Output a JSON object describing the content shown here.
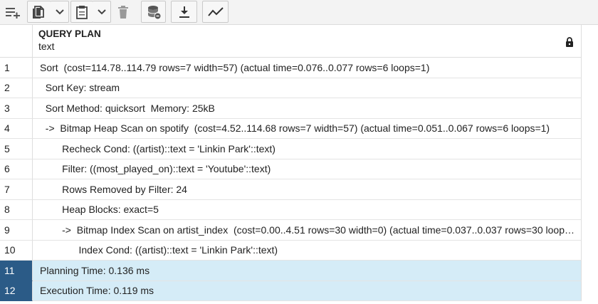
{
  "toolbar": {
    "buttons": [
      {
        "name": "add-row-icon"
      },
      {
        "name": "copy-icon"
      },
      {
        "name": "copy-dropdown-icon"
      },
      {
        "name": "paste-icon"
      },
      {
        "name": "paste-dropdown-icon"
      },
      {
        "name": "delete-icon"
      },
      {
        "name": "save-data-icon"
      },
      {
        "name": "download-icon"
      },
      {
        "name": "graph-visualiser-icon"
      }
    ]
  },
  "grid": {
    "column_header": {
      "title": "QUERY PLAN",
      "type": "text",
      "locked": true
    },
    "rows": [
      {
        "num": "1",
        "text": "Sort  (cost=114.78..114.79 rows=7 width=57) (actual time=0.076..0.077 rows=6 loops=1)",
        "selected": false
      },
      {
        "num": "2",
        "text": "  Sort Key: stream",
        "selected": false
      },
      {
        "num": "3",
        "text": "  Sort Method: quicksort  Memory: 25kB",
        "selected": false
      },
      {
        "num": "4",
        "text": "  ->  Bitmap Heap Scan on spotify  (cost=4.52..114.68 rows=7 width=57) (actual time=0.051..0.067 rows=6 loops=1)",
        "selected": false
      },
      {
        "num": "5",
        "text": "        Recheck Cond: ((artist)::text = 'Linkin Park'::text)",
        "selected": false
      },
      {
        "num": "6",
        "text": "        Filter: ((most_played_on)::text = 'Youtube'::text)",
        "selected": false
      },
      {
        "num": "7",
        "text": "        Rows Removed by Filter: 24",
        "selected": false
      },
      {
        "num": "8",
        "text": "        Heap Blocks: exact=5",
        "selected": false
      },
      {
        "num": "9",
        "text": "        ->  Bitmap Index Scan on artist_index  (cost=0.00..4.51 rows=30 width=0) (actual time=0.037..0.037 rows=30 loop…",
        "selected": false
      },
      {
        "num": "10",
        "text": "              Index Cond: ((artist)::text = 'Linkin Park'::text)",
        "selected": false
      },
      {
        "num": "11",
        "text": "Planning Time: 0.136 ms",
        "selected": true
      },
      {
        "num": "12",
        "text": "Execution Time: 0.119 ms",
        "selected": true
      }
    ]
  },
  "colors": {
    "selected_rownum_bg": "#2b5b87",
    "selected_cell_bg": "#d5ecf7",
    "toolbar_bg": "#f3f3f3"
  }
}
